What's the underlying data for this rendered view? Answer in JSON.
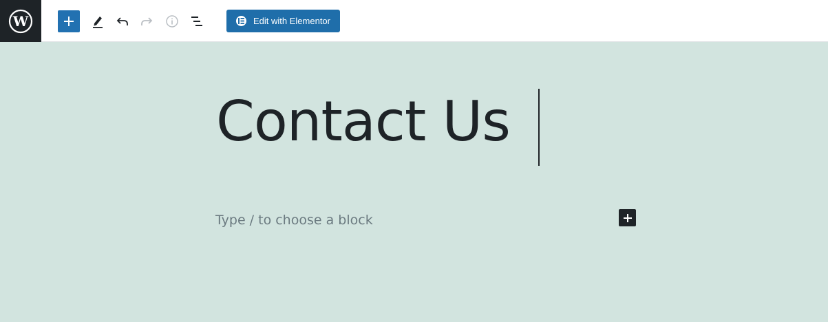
{
  "toolbar": {
    "logo_icon": "wordpress-logo-icon",
    "add_block_icon": "plus-icon",
    "tools_icon": "pencil-icon",
    "undo_icon": "undo-icon",
    "redo_icon": "redo-icon",
    "details_icon": "info-icon",
    "outline_icon": "list-view-icon",
    "elementor_label": "Edit with Elementor",
    "elementor_icon": "elementor-icon"
  },
  "editor": {
    "title": "Contact Us",
    "placeholder": "Type / to choose a block",
    "inserter_icon": "plus-icon"
  },
  "colors": {
    "accent": "#2271b1",
    "elementor": "#1f6eaa",
    "dark": "#1e2327",
    "canvas": "#d2e4df"
  }
}
